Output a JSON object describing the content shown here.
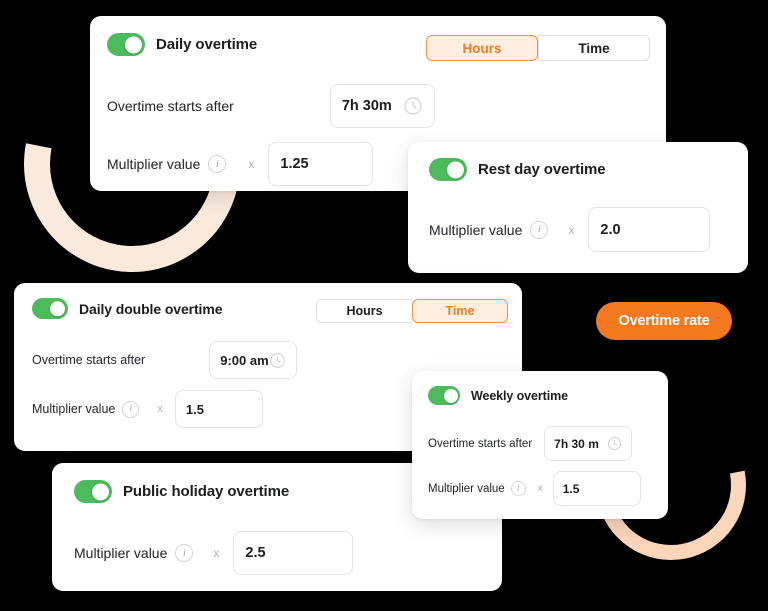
{
  "theme": {
    "background": "#000000",
    "card_background": "#FFFFFF",
    "accent_orange": "#F47920",
    "accent_orange_soft_bg": "#FDEEE1",
    "accent_orange_border": "#F0934A",
    "toggle_green": "#4CBB5C",
    "arc_left_color": "#FBEADB",
    "arc_right_color": "#FBD6BB",
    "text_primary": "#1C1D21",
    "field_border": "#E2E3E8"
  },
  "pill": {
    "label": "Overtime rate",
    "icon": "none"
  },
  "labels": {
    "overtime_starts_after": "Overtime starts after",
    "multiplier_value": "Multiplier value",
    "times_sign": "x",
    "info_icon_glyph": "i",
    "clock_icon": "clock-icon"
  },
  "segmented_options": {
    "hours": "Hours",
    "time": "Time"
  },
  "cards": [
    {
      "id": "daily",
      "title": "Daily overtime",
      "toggle_on": true,
      "has_segmented": true,
      "segmented_active": "Hours",
      "starts_after_label": "Overtime starts after",
      "starts_after_value": "7h 30m",
      "multiplier_label": "Multiplier value",
      "multiplier_value": "1.25"
    },
    {
      "id": "rest",
      "title": "Rest day overtime",
      "toggle_on": true,
      "has_segmented": false,
      "multiplier_label": "Multiplier value",
      "multiplier_value": "2.0"
    },
    {
      "id": "double",
      "title": "Daily double overtime",
      "toggle_on": true,
      "has_segmented": true,
      "segmented_active": "Time",
      "starts_after_label": "Overtime starts after",
      "starts_after_value": "9:00 am",
      "multiplier_label": "Multiplier value",
      "multiplier_value": "1.5"
    },
    {
      "id": "weekly",
      "title": "Weekly overtime",
      "toggle_on": true,
      "has_segmented": false,
      "starts_after_label": "Overtime starts after",
      "starts_after_value": "7h 30 m",
      "multiplier_label": "Multiplier value",
      "multiplier_value": "1.5"
    },
    {
      "id": "public",
      "title": "Public holiday overtime",
      "toggle_on": true,
      "has_segmented": false,
      "multiplier_label": "Multiplier value",
      "multiplier_value": "2.5"
    }
  ]
}
